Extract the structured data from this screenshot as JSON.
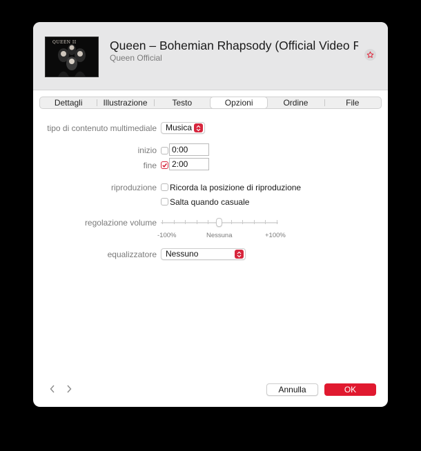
{
  "header": {
    "title": "Queen – Bohemian Rhapsody (Official Video R…",
    "artist": "Queen Official",
    "artwork_text": "QUEEN II"
  },
  "tabs": [
    "Dettagli",
    "Illustrazione",
    "Testo",
    "Opzioni",
    "Ordine",
    "File"
  ],
  "active_tab": "Opzioni",
  "options": {
    "media_kind_label": "tipo di contenuto multimediale",
    "media_kind_value": "Musica",
    "start_label": "inizio",
    "start_checked": false,
    "start_value": "0:00",
    "end_label": "fine",
    "end_checked": true,
    "end_value": "2:00",
    "playback_label": "riproduzione",
    "remember_position": "Ricorda la posizione di riproduzione",
    "skip_shuffle": "Salta quando casuale",
    "volume_label": "regolazione volume",
    "volume_min": "-100%",
    "volume_mid": "Nessuna",
    "volume_max": "+100%",
    "volume_value": 0,
    "eq_label": "equalizzatore",
    "eq_value": "Nessuno"
  },
  "footer": {
    "cancel": "Annulla",
    "ok": "OK"
  },
  "colors": {
    "accent": "#e0192f",
    "background": "#000000",
    "header_bg": "#e7e7e8"
  },
  "icons": [
    "chevron-left-icon",
    "chevron-right-icon",
    "star-icon",
    "popup-arrows-icon",
    "checkmark-icon"
  ]
}
